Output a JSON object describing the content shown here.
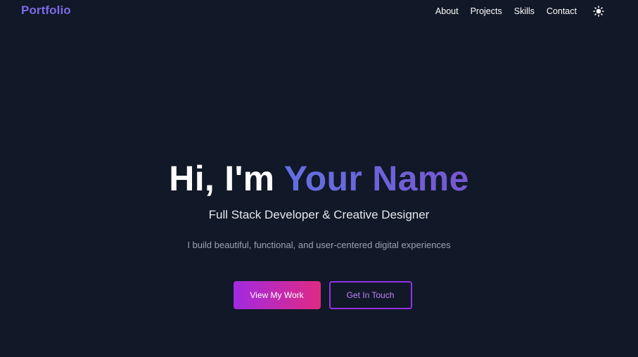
{
  "navbar": {
    "logo": "Portfolio",
    "links": [
      "About",
      "Projects",
      "Skills",
      "Contact"
    ],
    "theme_icon": "sun-icon"
  },
  "hero": {
    "greeting": "Hi, I'm ",
    "name": "Your Name",
    "subtitle": "Full Stack Developer & Creative Designer",
    "description": "I build beautiful, functional, and user-centered digital experiences"
  },
  "buttons": {
    "primary": "View My Work",
    "secondary": "Get In Touch"
  },
  "colors": {
    "background": "#111827",
    "accent": "#7c6ae6",
    "gradient_start": "#a22ae0",
    "gradient_end": "#df2a83",
    "outline": "#9333ea"
  }
}
